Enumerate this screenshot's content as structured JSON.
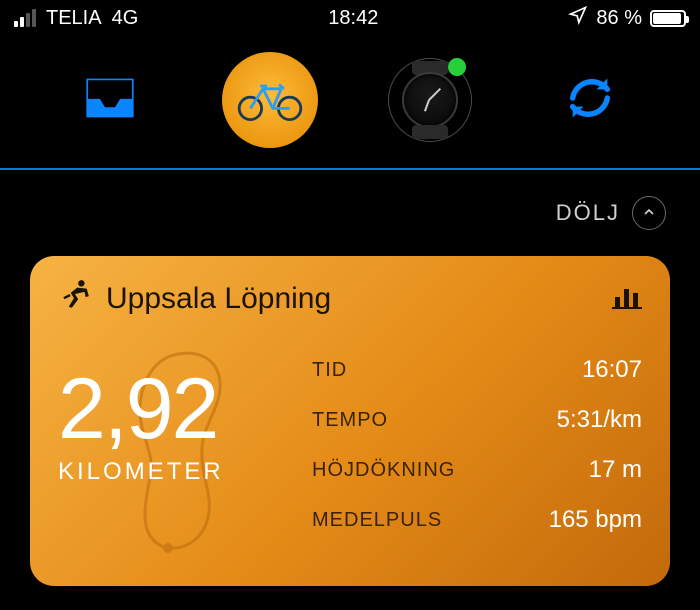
{
  "status": {
    "carrier": "TELIA",
    "network": "4G",
    "time": "18:42",
    "battery_pct": "86 %"
  },
  "hide_label": "DÖLJ",
  "activity": {
    "title": "Uppsala Löpning",
    "distance_value": "2,92",
    "distance_unit": "KILOMETER",
    "stats": [
      {
        "label": "TID",
        "value": "16:07"
      },
      {
        "label": "TEMPO",
        "value": "5:31/km"
      },
      {
        "label": "HÖJDÖKNING",
        "value": "17 m"
      },
      {
        "label": "MEDELPULS",
        "value": "165 bpm"
      }
    ]
  },
  "icons": {
    "inbox": "inbox-icon",
    "bike": "bike-icon",
    "watch": "watch-icon",
    "sync": "sync-icon",
    "runner": "runner-icon",
    "chart": "bar-chart-icon",
    "chevron": "chevron-up-icon",
    "location": "location-arrow-icon"
  },
  "colors": {
    "accent_blue": "#0a84ff",
    "card_gradient_from": "#f6b343",
    "card_gradient_to": "#c26a0b",
    "green_dot": "#26d03b"
  }
}
